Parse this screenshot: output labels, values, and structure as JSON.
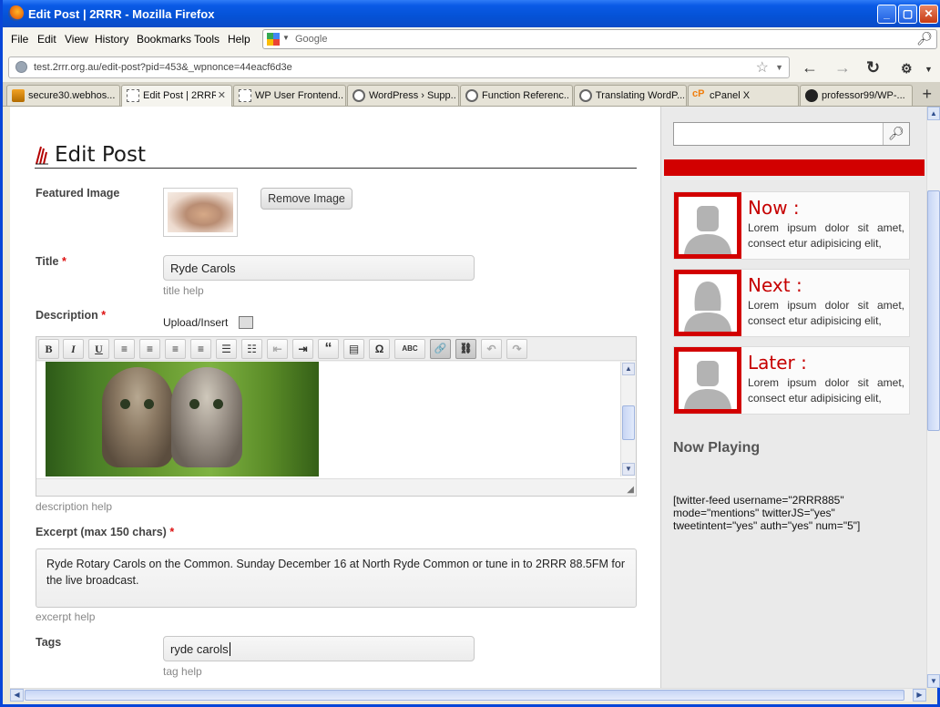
{
  "window": {
    "title": "Edit Post | 2RRR - Mozilla Firefox",
    "controls": {
      "minimize": "_",
      "maximize": "▢",
      "close": "✕"
    }
  },
  "menu": [
    "File",
    "Edit",
    "View",
    "History",
    "Bookmarks",
    "Tools",
    "Help"
  ],
  "search_engine": {
    "placeholder": "Google",
    "icon": "google-icon"
  },
  "address": {
    "url": "test.2rrr.org.au/edit-post?pid=453&_wpnonce=44eacf6d3e"
  },
  "tabs": [
    {
      "label": "secure30.webhos...",
      "icon": "phpmyadmin-icon",
      "active": false
    },
    {
      "label": "Edit Post | 2RRR",
      "icon": "page-icon",
      "active": true
    },
    {
      "label": "WP User Frontend...",
      "icon": "page-icon",
      "active": false
    },
    {
      "label": "WordPress › Supp...",
      "icon": "wordpress-icon",
      "active": false
    },
    {
      "label": "Function Referenc...",
      "icon": "wordpress-icon",
      "active": false
    },
    {
      "label": "Translating WordP...",
      "icon": "wordpress-icon",
      "active": false
    },
    {
      "label": "cPanel X",
      "icon": "cpanel-icon",
      "active": false
    },
    {
      "label": "professor99/WP-...",
      "icon": "github-icon",
      "active": false
    }
  ],
  "form": {
    "heading": "Edit Post",
    "featured_image": {
      "label": "Featured Image",
      "remove_button": "Remove Image"
    },
    "title": {
      "label": "Title",
      "required": "*",
      "value": "Ryde Carols",
      "help": "title help"
    },
    "description": {
      "label": "Description",
      "required": "*",
      "upload_label": "Upload/Insert",
      "help": "description help",
      "toolbar": [
        {
          "name": "bold",
          "glyph": "B"
        },
        {
          "name": "italic",
          "glyph": "I"
        },
        {
          "name": "underline",
          "glyph": "U"
        },
        {
          "name": "align-left",
          "glyph": "≡"
        },
        {
          "name": "align-center",
          "glyph": "≡"
        },
        {
          "name": "align-right",
          "glyph": "≡"
        },
        {
          "name": "align-justify",
          "glyph": "≡"
        },
        {
          "name": "bullet-list",
          "glyph": "☰"
        },
        {
          "name": "numbered-list",
          "glyph": "☷"
        },
        {
          "name": "outdent",
          "glyph": "⇤"
        },
        {
          "name": "indent",
          "glyph": "⇥"
        },
        {
          "name": "blockquote",
          "glyph": "“"
        },
        {
          "name": "horizontal-rule",
          "glyph": "▤"
        },
        {
          "name": "special-char",
          "glyph": "Ω"
        },
        {
          "name": "spellcheck",
          "glyph": "ABC"
        },
        {
          "name": "link",
          "glyph": "🔗"
        },
        {
          "name": "unlink",
          "glyph": "⛓"
        },
        {
          "name": "undo",
          "glyph": "↶"
        },
        {
          "name": "redo",
          "glyph": "↷"
        }
      ]
    },
    "excerpt": {
      "label": "Excerpt (max 150 chars)",
      "required": "*",
      "value": "Ryde Rotary Carols on the Common. Sunday December 16 at North Ryde Common or tune in to 2RRR 88.5FM for the live broadcast.",
      "help": "excerpt help"
    },
    "tags": {
      "label": "Tags",
      "value": "ryde carols",
      "help": "tag help"
    }
  },
  "sidebar": {
    "search_placeholder": "",
    "accent_color": "#d20000",
    "schedule": [
      {
        "title": "Now :",
        "body": "Lorem ipsum dolor sit amet, consect etur adipisicing elit,",
        "avatar": "male"
      },
      {
        "title": "Next :",
        "body": "Lorem ipsum dolor sit amet, consect etur adipisicing elit,",
        "avatar": "female"
      },
      {
        "title": "Later :",
        "body": "Lorem ipsum dolor sit amet, consect etur adipisicing elit,",
        "avatar": "male"
      }
    ],
    "now_playing": "Now Playing",
    "shortcode": "[twitter-feed username=\"2RRR885\" mode=\"mentions\" twitterJS=\"yes\" tweetintent=\"yes\" auth=\"yes\" num=\"5\"]"
  }
}
